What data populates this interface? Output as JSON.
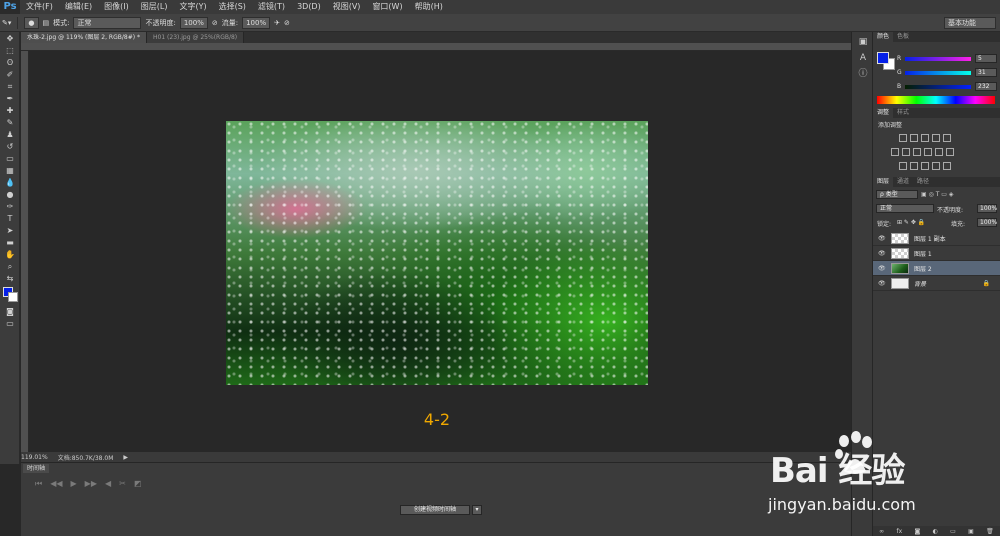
{
  "app": {
    "logo": "Ps"
  },
  "menu": [
    "文件(F)",
    "编辑(E)",
    "图像(I)",
    "图层(L)",
    "文字(Y)",
    "选择(S)",
    "滤镜(T)",
    "3D(D)",
    "视图(V)",
    "窗口(W)",
    "帮助(H)"
  ],
  "options": {
    "mode_label": "模式:",
    "mode_value": "正常",
    "opacity_label": "不透明度:",
    "opacity_value": "100%",
    "flow_label": "流量:",
    "flow_value": "100%",
    "workspace": "基本功能"
  },
  "tabs": [
    {
      "label": "水珠-2.jpg @ 119% (图层 2, RGB/8#) *",
      "active": true
    },
    {
      "label": "H01 (23).jpg @ 25%(RGB/8)",
      "active": false
    }
  ],
  "canvas": {
    "caption": "4-2"
  },
  "status": {
    "zoom": "119.01%",
    "doc": "文档:850.7K/38.0M"
  },
  "timeline": {
    "tab": "时间轴",
    "create_button": "创建视频时间轴"
  },
  "color_panel": {
    "tabs": [
      "颜色",
      "色板"
    ],
    "fg": "#0520e8",
    "bg": "#ffffff",
    "channels": [
      {
        "label": "R",
        "value": "5"
      },
      {
        "label": "G",
        "value": "31"
      },
      {
        "label": "B",
        "value": "232"
      }
    ]
  },
  "adjustments": {
    "tabs": [
      "调整",
      "样式"
    ],
    "title": "添加调整"
  },
  "layers_panel": {
    "tabs": [
      "图层",
      "通道",
      "路径"
    ],
    "kind": "ρ 类型",
    "blend": "正常",
    "opacity_label": "不透明度:",
    "opacity": "100%",
    "lock_label": "锁定:",
    "fill_label": "填充:",
    "fill": "100%",
    "layers": [
      {
        "name": "图层 1 副本",
        "thumb": "transparent",
        "selected": false
      },
      {
        "name": "图层 1",
        "thumb": "transparent",
        "selected": false
      },
      {
        "name": "图层 2",
        "thumb": "photo",
        "selected": true
      },
      {
        "name": "背景",
        "thumb": "white",
        "selected": false,
        "locked": true
      }
    ]
  },
  "watermark": {
    "brand": "Bai  经验",
    "site": "jingyan.baidu.com"
  }
}
